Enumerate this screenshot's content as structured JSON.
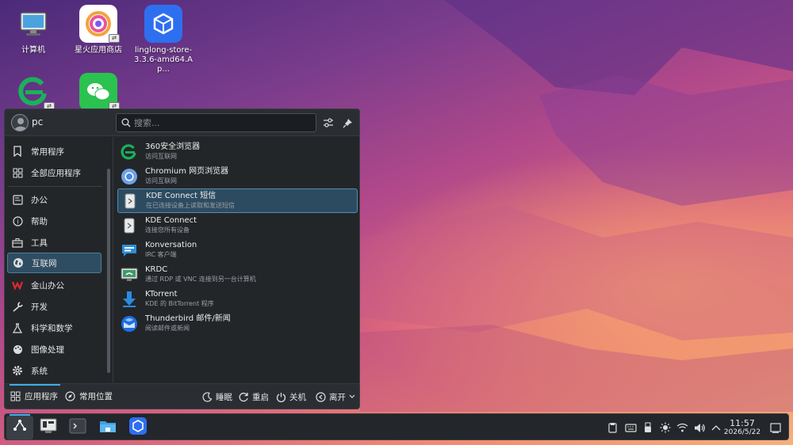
{
  "desktop": {
    "icons": [
      {
        "label": "计算机",
        "icon": "computer-icon"
      },
      {
        "label": "星火应用商店",
        "icon": "spark-store-icon"
      },
      {
        "label": "linglong-store-3.3.6-amd64.Ap...",
        "icon": "linglong-store-icon"
      },
      {
        "label": "",
        "icon": "360-browser-icon"
      },
      {
        "label": "",
        "icon": "wechat-icon"
      }
    ]
  },
  "launcher": {
    "user": "pc",
    "search_placeholder": "搜索...",
    "categories": [
      {
        "label": "常用程序",
        "icon": "bookmark-icon"
      },
      {
        "label": "全部应用程序",
        "icon": "grid-icon"
      },
      {
        "label": "办公",
        "icon": "office-icon"
      },
      {
        "label": "帮助",
        "icon": "help-icon"
      },
      {
        "label": "工具",
        "icon": "toolbox-icon"
      },
      {
        "label": "互联网",
        "icon": "globe-icon",
        "active": true
      },
      {
        "label": "金山办公",
        "icon": "wps-icon"
      },
      {
        "label": "开发",
        "icon": "wrench-icon"
      },
      {
        "label": "科学和数学",
        "icon": "flask-icon"
      },
      {
        "label": "图像处理",
        "icon": "palette-icon"
      },
      {
        "label": "系统",
        "icon": "gear-icon"
      }
    ],
    "apps": [
      {
        "name": "360安全浏览器",
        "desc": "访问互联网",
        "icon": "360-browser-icon"
      },
      {
        "name": "Chromium 网页浏览器",
        "desc": "访问互联网",
        "icon": "chromium-icon"
      },
      {
        "name": "KDE Connect 短信",
        "desc": "在已连接设备上读取和发送短信",
        "icon": "kdeconnect-sms-icon",
        "highlighted": true
      },
      {
        "name": "KDE Connect",
        "desc": "连接您所有设备",
        "icon": "kdeconnect-icon"
      },
      {
        "name": "Konversation",
        "desc": "IRC 客户端",
        "icon": "konversation-icon"
      },
      {
        "name": "KRDC",
        "desc": "通过 RDP 或 VNC 连接到另一台计算机",
        "icon": "krdc-icon"
      },
      {
        "name": "KTorrent",
        "desc": "KDE 的 BitTorrent 程序",
        "icon": "ktorrent-icon"
      },
      {
        "name": "Thunderbird 邮件/新闻",
        "desc": "阅读邮件或新闻",
        "icon": "thunderbird-icon"
      }
    ],
    "footer": {
      "tab_apps": "应用程序",
      "tab_places": "常用位置",
      "sleep": "睡眠",
      "restart": "重启",
      "shutdown": "关机",
      "leave": "离开"
    }
  },
  "taskbar": {
    "clock_time": "11:57",
    "clock_date": "2026/5/22"
  },
  "colors": {
    "accent": "#3daee9",
    "panel_bg": "#232629",
    "highlight": "#2d4b60"
  }
}
